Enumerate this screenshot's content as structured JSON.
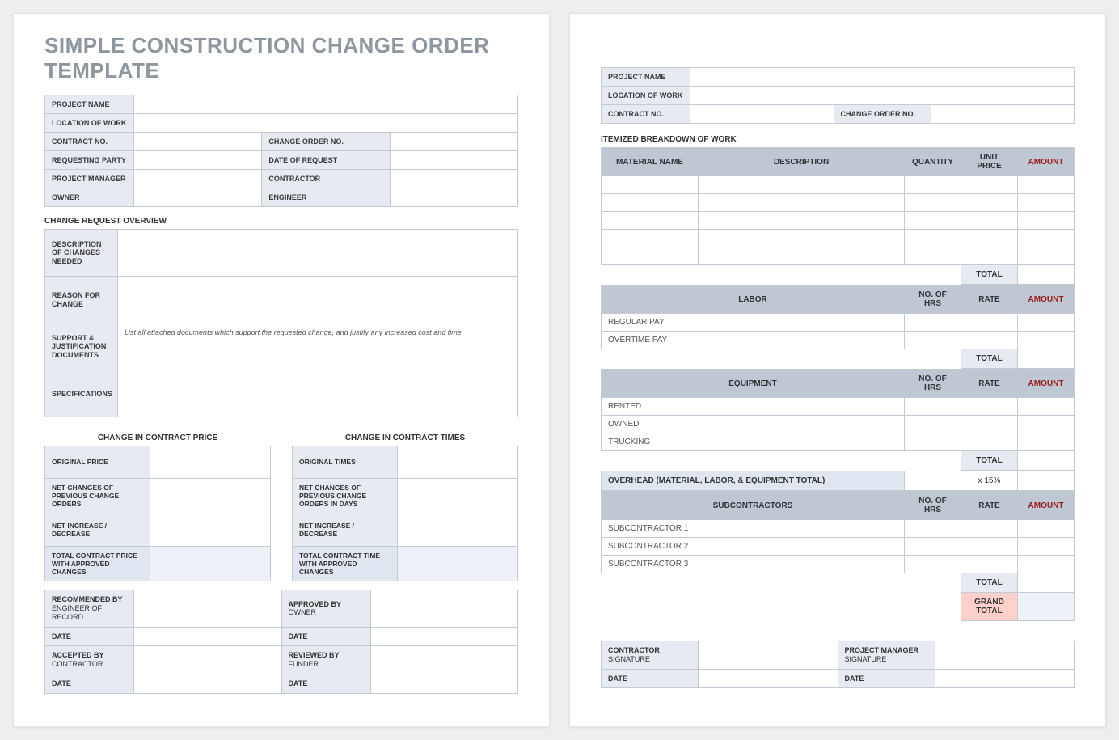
{
  "title": "SIMPLE CONSTRUCTION CHANGE ORDER TEMPLATE",
  "header": {
    "project_name": "PROJECT NAME",
    "location_of_work": "LOCATION OF WORK",
    "contract_no": "CONTRACT NO.",
    "change_order_no": "CHANGE ORDER NO.",
    "requesting_party": "REQUESTING PARTY",
    "date_of_request": "DATE OF REQUEST",
    "project_manager": "PROJECT MANAGER",
    "contractor": "CONTRACTOR",
    "owner": "OWNER",
    "engineer": "ENGINEER"
  },
  "overview": {
    "title": "CHANGE REQUEST OVERVIEW",
    "desc_changes": "DESCRIPTION OF CHANGES NEEDED",
    "reason": "REASON FOR CHANGE",
    "support_docs": "SUPPORT & JUSTIFICATION DOCUMENTS",
    "support_docs_hint": "List all attached documents which support the requested change, and justify any increased cost and time.",
    "specs": "SPECIFICATIONS"
  },
  "price": {
    "title": "CHANGE IN CONTRACT PRICE",
    "original": "ORIGINAL PRICE",
    "net_prev": "NET CHANGES OF PREVIOUS CHANGE ORDERS",
    "net_inc_dec": "NET INCREASE / DECREASE",
    "total": "TOTAL CONTRACT PRICE WITH APPROVED CHANGES"
  },
  "time": {
    "title": "CHANGE IN CONTRACT TIMES",
    "original": "ORIGINAL TIMES",
    "net_prev": "NET CHANGES OF PREVIOUS CHANGE ORDERS IN DAYS",
    "net_inc_dec": "NET INCREASE / DECREASE",
    "total": "TOTAL CONTRACT TIME WITH APPROVED CHANGES"
  },
  "sig": {
    "recommended_by": "RECOMMENDED BY",
    "recommended_sub": "ENGINEER OF RECORD",
    "approved_by": "APPROVED BY",
    "approved_sub": "OWNER",
    "accepted_by": "ACCEPTED BY",
    "accepted_sub": "CONTRACTOR",
    "reviewed_by": "REVIEWED BY",
    "reviewed_sub": "FUNDER",
    "date": "DATE"
  },
  "page2": {
    "itemized_title": "ITEMIZED BREAKDOWN OF WORK",
    "material_name": "MATERIAL NAME",
    "description": "DESCRIPTION",
    "quantity": "QUANTITY",
    "unit_price": "UNIT PRICE",
    "amount": "AMOUNT",
    "total": "TOTAL",
    "labor": "LABOR",
    "no_of_hrs": "NO. OF HRS",
    "rate": "RATE",
    "regular_pay": "REGULAR PAY",
    "overtime_pay": "OVERTIME PAY",
    "equipment": "EQUIPMENT",
    "rented": "RENTED",
    "owned": "OWNED",
    "trucking": "TRUCKING",
    "overhead": "OVERHEAD (MATERIAL, LABOR, & EQUIPMENT TOTAL)",
    "overhead_rate": "x 15%",
    "subcontractors": "SUBCONTRACTORS",
    "sub1": "SUBCONTRACTOR 1",
    "sub2": "SUBCONTRACTOR 2",
    "sub3": "SUBCONTRACTOR 3",
    "grand_total": "GRAND TOTAL",
    "sig_contractor": "CONTRACTOR",
    "sig_pm": "PROJECT MANAGER",
    "sig_signature": "SIGNATURE",
    "sig_date": "DATE"
  }
}
